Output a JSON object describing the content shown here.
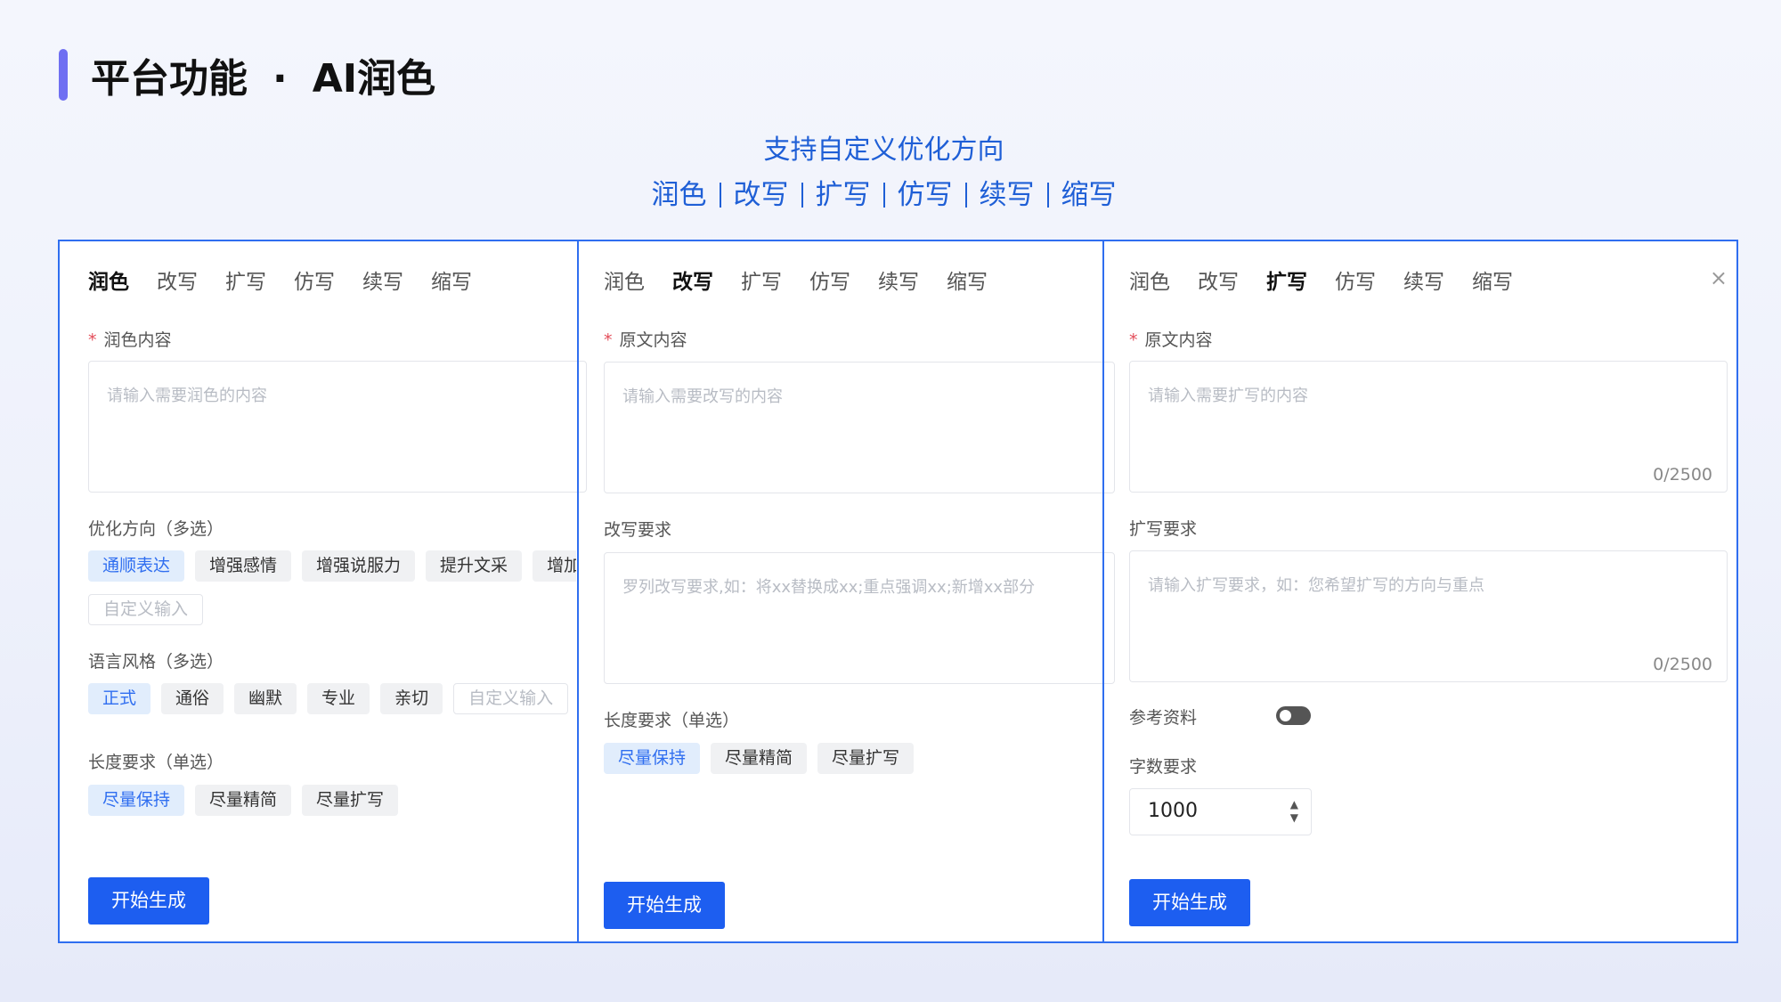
{
  "header": {
    "title_left": "平台功能",
    "title_dot": "·",
    "title_right": "AI润色",
    "subtitle": "支持自定义优化方向",
    "modes": [
      "润色",
      "改写",
      "扩写",
      "仿写",
      "续写",
      "缩写"
    ]
  },
  "tabs": [
    "润色",
    "改写",
    "扩写",
    "仿写",
    "续写",
    "缩写"
  ],
  "panel_polish": {
    "active_tab": "润色",
    "content_label": "润色内容",
    "content_placeholder": "请输入需要润色的内容",
    "direction_label": "优化方向（多选）",
    "direction_chips": [
      "通顺表达",
      "增强感情",
      "增强说服力",
      "提升文采",
      "增加细节"
    ],
    "direction_selected": "通顺表达",
    "direction_custom": "自定义输入",
    "style_label": "语言风格（多选）",
    "style_chips": [
      "正式",
      "通俗",
      "幽默",
      "专业",
      "亲切"
    ],
    "style_selected": "正式",
    "style_custom": "自定义输入",
    "length_label": "长度要求（单选）",
    "length_chips": [
      "尽量保持",
      "尽量精简",
      "尽量扩写"
    ],
    "length_selected": "尽量保持",
    "submit": "开始生成"
  },
  "panel_rewrite": {
    "active_tab": "改写",
    "content_label": "原文内容",
    "content_placeholder": "请输入需要改写的内容",
    "req_label": "改写要求",
    "req_placeholder": "罗列改写要求,如：将xx替换成xx;重点强调xx;新增xx部分",
    "length_label": "长度要求（单选）",
    "length_chips": [
      "尽量保持",
      "尽量精简",
      "尽量扩写"
    ],
    "length_selected": "尽量保持",
    "submit": "开始生成"
  },
  "panel_expand": {
    "active_tab": "扩写",
    "close": "×",
    "content_label": "原文内容",
    "content_placeholder": "请输入需要扩写的内容",
    "content_counter": "0/2500",
    "req_label": "扩写要求",
    "req_placeholder": "请输入扩写要求，如：您希望扩写的方向与重点",
    "req_counter": "0/2500",
    "ref_label": "参考资料",
    "ref_enabled": false,
    "words_label": "字数要求",
    "words_value": "1000",
    "submit": "开始生成"
  },
  "colors": {
    "accent": "#1d5ef0",
    "border": "#2f6ef0",
    "title_bar": "#6f6ff2",
    "subtitle": "#1f5fd6"
  }
}
